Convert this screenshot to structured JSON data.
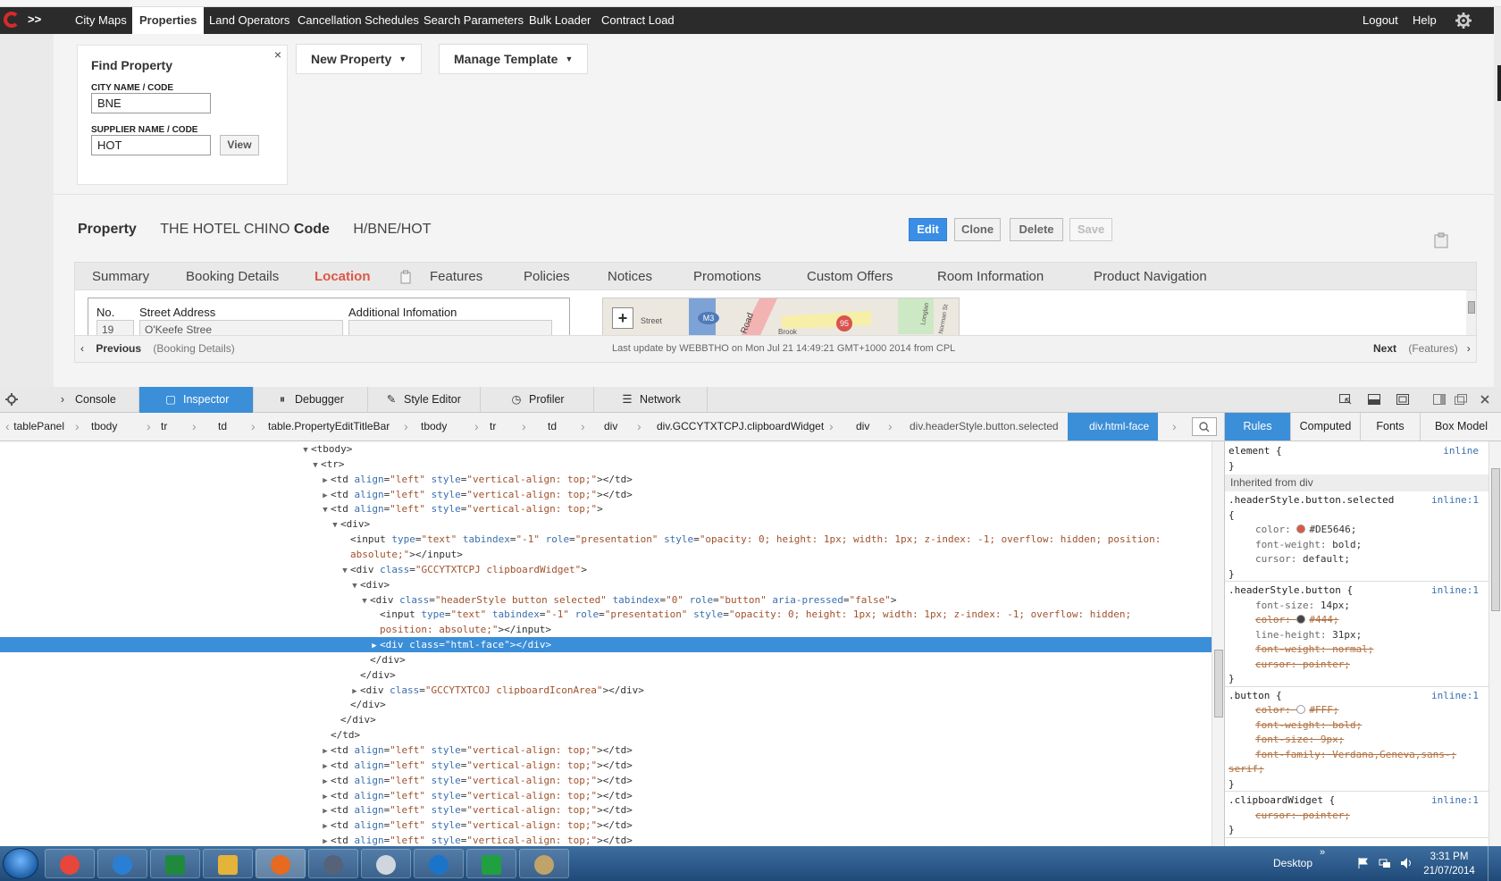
{
  "nav": {
    "items": [
      "City Maps",
      "Properties",
      "Land Operators",
      "Cancellation Schedules",
      "Search Parameters",
      "Bulk Loader",
      "Contract Load"
    ],
    "active": "Properties",
    "logout": "Logout",
    "help": "Help",
    "rail_chevron": ">>"
  },
  "find": {
    "title": "Find Property",
    "close": "×",
    "city_label": "CITY NAME / CODE",
    "city_value": "BNE",
    "supplier_label": "SUPPLIER NAME / CODE",
    "supplier_value": "HOT",
    "view": "View"
  },
  "toolbar": {
    "new_property": "New Property",
    "manage_template": "Manage Template",
    "caret": "▼"
  },
  "property": {
    "label": "Property",
    "name": "THE HOTEL CHINO",
    "code_label": "Code",
    "code": "H/BNE/HOT",
    "edit": "Edit",
    "clone": "Clone",
    "delete": "Delete",
    "save": "Save"
  },
  "tabs": [
    "Summary",
    "Booking Details",
    "Location",
    "Features",
    "Policies",
    "Notices",
    "Promotions",
    "Custom Offers",
    "Room Information",
    "Product Navigation"
  ],
  "selected_tab": "Location",
  "location": {
    "headers": [
      "No.",
      "Street Address",
      "Additional Infomation"
    ],
    "no": "19",
    "street": "O'Keefe Stree",
    "additional": "",
    "map_zoom": "+",
    "map_labels": [
      "Street",
      "M3",
      "Road",
      "95",
      "Brook",
      "Norman St",
      "Longlan"
    ]
  },
  "pager": {
    "previous": "Previous",
    "previous_target": "(Booking Details)",
    "update": "Last update by WEBBTHO on Mon Jul 21 14:49:21 GMT+1000 2014 from CPL",
    "next": "Next",
    "next_target": "(Features)"
  },
  "devtools": {
    "tabs": [
      {
        "label": "Console",
        "icon": "›"
      },
      {
        "label": "Inspector",
        "icon": "▢"
      },
      {
        "label": "Debugger",
        "icon": "⏸"
      },
      {
        "label": "Style Editor",
        "icon": "✎"
      },
      {
        "label": "Profiler",
        "icon": "◷"
      },
      {
        "label": "Network",
        "icon": "☰"
      }
    ],
    "active_tab": "Inspector",
    "breadcrumbs": [
      "tablePanel",
      "tbody",
      "tr",
      "td",
      "table.PropertyEditTitleBar",
      "tbody",
      "tr",
      "td",
      "div",
      "div.GCCYTXTCPJ.clipboardWidget",
      "div",
      "div.headerStyle.button.selected",
      "div.html-face"
    ],
    "sidebar_tabs": [
      "Rules",
      "Computed",
      "Fonts",
      "Box Model"
    ],
    "active_sidebar_tab": "Rules"
  },
  "markup": [
    {
      "indent": 0,
      "tw": "▼",
      "parts": [
        [
          "t",
          "<tbody>"
        ]
      ]
    },
    {
      "indent": 1,
      "tw": "▼",
      "parts": [
        [
          "t",
          "<tr>"
        ]
      ]
    },
    {
      "indent": 2,
      "tw": "▶",
      "parts": [
        [
          "t",
          "<td "
        ],
        [
          "an",
          "align"
        ],
        [
          "t",
          "="
        ],
        [
          "av",
          "\"left\""
        ],
        [
          "t",
          " "
        ],
        [
          "an",
          "style"
        ],
        [
          "t",
          "="
        ],
        [
          "av",
          "\"vertical-align: top;\""
        ],
        [
          "t",
          "></td>"
        ]
      ]
    },
    {
      "indent": 2,
      "tw": "▶",
      "parts": [
        [
          "t",
          "<td "
        ],
        [
          "an",
          "align"
        ],
        [
          "t",
          "="
        ],
        [
          "av",
          "\"left\""
        ],
        [
          "t",
          " "
        ],
        [
          "an",
          "style"
        ],
        [
          "t",
          "="
        ],
        [
          "av",
          "\"vertical-align: top;\""
        ],
        [
          "t",
          "></td>"
        ]
      ]
    },
    {
      "indent": 2,
      "tw": "▼",
      "parts": [
        [
          "t",
          "<td "
        ],
        [
          "an",
          "align"
        ],
        [
          "t",
          "="
        ],
        [
          "av",
          "\"left\""
        ],
        [
          "t",
          " "
        ],
        [
          "an",
          "style"
        ],
        [
          "t",
          "="
        ],
        [
          "av",
          "\"vertical-align: top;\""
        ],
        [
          "t",
          ">"
        ]
      ]
    },
    {
      "indent": 3,
      "tw": "▼",
      "parts": [
        [
          "t",
          "<div>"
        ]
      ]
    },
    {
      "indent": 4,
      "tw": "",
      "parts": [
        [
          "t",
          "<input "
        ],
        [
          "an",
          "type"
        ],
        [
          "t",
          "="
        ],
        [
          "av",
          "\"text\""
        ],
        [
          "t",
          " "
        ],
        [
          "an",
          "tabindex"
        ],
        [
          "t",
          "="
        ],
        [
          "av",
          "\"-1\""
        ],
        [
          "t",
          " "
        ],
        [
          "an",
          "role"
        ],
        [
          "t",
          "="
        ],
        [
          "av",
          "\"presentation\""
        ],
        [
          "t",
          " "
        ],
        [
          "an",
          "style"
        ],
        [
          "t",
          "="
        ],
        [
          "av",
          "\"opacity: 0; height: 1px; width: 1px; z-index: -1; overflow: hidden; position:"
        ]
      ]
    },
    {
      "indent": 4,
      "tw": "",
      "parts": [
        [
          "av",
          "absolute;\""
        ],
        [
          "t",
          "></input>"
        ]
      ]
    },
    {
      "indent": 4,
      "tw": "▼",
      "parts": [
        [
          "t",
          "<div "
        ],
        [
          "an",
          "class"
        ],
        [
          "t",
          "="
        ],
        [
          "av",
          "\"GCCYTXTCPJ clipboardWidget\""
        ],
        [
          "t",
          ">"
        ]
      ]
    },
    {
      "indent": 5,
      "tw": "▼",
      "parts": [
        [
          "t",
          "<div>"
        ]
      ]
    },
    {
      "indent": 6,
      "tw": "▼",
      "parts": [
        [
          "t",
          "<div "
        ],
        [
          "an",
          "class"
        ],
        [
          "t",
          "="
        ],
        [
          "av",
          "\"headerStyle button selected\""
        ],
        [
          "t",
          " "
        ],
        [
          "an",
          "tabindex"
        ],
        [
          "t",
          "="
        ],
        [
          "av",
          "\"0\""
        ],
        [
          "t",
          " "
        ],
        [
          "an",
          "role"
        ],
        [
          "t",
          "="
        ],
        [
          "av",
          "\"button\""
        ],
        [
          "t",
          " "
        ],
        [
          "an",
          "aria-pressed"
        ],
        [
          "t",
          "="
        ],
        [
          "av",
          "\"false\""
        ],
        [
          "t",
          ">"
        ]
      ]
    },
    {
      "indent": 7,
      "tw": "",
      "parts": [
        [
          "t",
          "<input "
        ],
        [
          "an",
          "type"
        ],
        [
          "t",
          "="
        ],
        [
          "av",
          "\"text\""
        ],
        [
          "t",
          " "
        ],
        [
          "an",
          "tabindex"
        ],
        [
          "t",
          "="
        ],
        [
          "av",
          "\"-1\""
        ],
        [
          "t",
          " "
        ],
        [
          "an",
          "role"
        ],
        [
          "t",
          "="
        ],
        [
          "av",
          "\"presentation\""
        ],
        [
          "t",
          " "
        ],
        [
          "an",
          "style"
        ],
        [
          "t",
          "="
        ],
        [
          "av",
          "\"opacity: 0; height: 1px; width: 1px; z-index: -1; overflow: hidden;"
        ]
      ]
    },
    {
      "indent": 7,
      "tw": "",
      "parts": [
        [
          "av",
          "position: absolute;\""
        ],
        [
          "t",
          "></input>"
        ]
      ]
    },
    {
      "indent": 7,
      "tw": "▶",
      "sel": true,
      "parts": [
        [
          "t",
          "<div "
        ],
        [
          "an",
          "class"
        ],
        [
          "t",
          "="
        ],
        [
          "av",
          "\"html-face\""
        ],
        [
          "t",
          "></div>"
        ]
      ]
    },
    {
      "indent": 6,
      "tw": "",
      "parts": [
        [
          "t",
          "</div>"
        ]
      ]
    },
    {
      "indent": 5,
      "tw": "",
      "parts": [
        [
          "t",
          "</div>"
        ]
      ]
    },
    {
      "indent": 5,
      "tw": "▶",
      "parts": [
        [
          "t",
          "<div "
        ],
        [
          "an",
          "class"
        ],
        [
          "t",
          "="
        ],
        [
          "av",
          "\"GCCYTXTCOJ clipboardIconArea\""
        ],
        [
          "t",
          "></div>"
        ]
      ]
    },
    {
      "indent": 4,
      "tw": "",
      "parts": [
        [
          "t",
          "</div>"
        ]
      ]
    },
    {
      "indent": 3,
      "tw": "",
      "parts": [
        [
          "t",
          "</div>"
        ]
      ]
    },
    {
      "indent": 2,
      "tw": "",
      "parts": [
        [
          "t",
          "</td>"
        ]
      ]
    },
    {
      "indent": 2,
      "tw": "▶",
      "parts": [
        [
          "t",
          "<td "
        ],
        [
          "an",
          "align"
        ],
        [
          "t",
          "="
        ],
        [
          "av",
          "\"left\""
        ],
        [
          "t",
          " "
        ],
        [
          "an",
          "style"
        ],
        [
          "t",
          "="
        ],
        [
          "av",
          "\"vertical-align: top;\""
        ],
        [
          "t",
          "></td>"
        ]
      ]
    },
    {
      "indent": 2,
      "tw": "▶",
      "parts": [
        [
          "t",
          "<td "
        ],
        [
          "an",
          "align"
        ],
        [
          "t",
          "="
        ],
        [
          "av",
          "\"left\""
        ],
        [
          "t",
          " "
        ],
        [
          "an",
          "style"
        ],
        [
          "t",
          "="
        ],
        [
          "av",
          "\"vertical-align: top;\""
        ],
        [
          "t",
          "></td>"
        ]
      ]
    },
    {
      "indent": 2,
      "tw": "▶",
      "parts": [
        [
          "t",
          "<td "
        ],
        [
          "an",
          "align"
        ],
        [
          "t",
          "="
        ],
        [
          "av",
          "\"left\""
        ],
        [
          "t",
          " "
        ],
        [
          "an",
          "style"
        ],
        [
          "t",
          "="
        ],
        [
          "av",
          "\"vertical-align: top;\""
        ],
        [
          "t",
          "></td>"
        ]
      ]
    },
    {
      "indent": 2,
      "tw": "▶",
      "parts": [
        [
          "t",
          "<td "
        ],
        [
          "an",
          "align"
        ],
        [
          "t",
          "="
        ],
        [
          "av",
          "\"left\""
        ],
        [
          "t",
          " "
        ],
        [
          "an",
          "style"
        ],
        [
          "t",
          "="
        ],
        [
          "av",
          "\"vertical-align: top;\""
        ],
        [
          "t",
          "></td>"
        ]
      ]
    },
    {
      "indent": 2,
      "tw": "▶",
      "parts": [
        [
          "t",
          "<td "
        ],
        [
          "an",
          "align"
        ],
        [
          "t",
          "="
        ],
        [
          "av",
          "\"left\""
        ],
        [
          "t",
          " "
        ],
        [
          "an",
          "style"
        ],
        [
          "t",
          "="
        ],
        [
          "av",
          "\"vertical-align: top;\""
        ],
        [
          "t",
          "></td>"
        ]
      ]
    },
    {
      "indent": 2,
      "tw": "▶",
      "parts": [
        [
          "t",
          "<td "
        ],
        [
          "an",
          "align"
        ],
        [
          "t",
          "="
        ],
        [
          "av",
          "\"left\""
        ],
        [
          "t",
          " "
        ],
        [
          "an",
          "style"
        ],
        [
          "t",
          "="
        ],
        [
          "av",
          "\"vertical-align: top;\""
        ],
        [
          "t",
          "></td>"
        ]
      ]
    },
    {
      "indent": 2,
      "tw": "▶",
      "parts": [
        [
          "t",
          "<td "
        ],
        [
          "an",
          "align"
        ],
        [
          "t",
          "="
        ],
        [
          "av",
          "\"left\""
        ],
        [
          "t",
          " "
        ],
        [
          "an",
          "style"
        ],
        [
          "t",
          "="
        ],
        [
          "av",
          "\"vertical-align: top;\""
        ],
        [
          "t",
          "></td>"
        ]
      ]
    }
  ],
  "rules": {
    "element_selector": "element {",
    "inline": "inline",
    "close": "}",
    "inherited": "Inherited from div",
    "blocks": [
      {
        "selector": ".headerStyle.button.selected",
        "src": "inline:1",
        "props": [
          {
            "name": "color",
            "value": "#DE5646",
            "swatch": "#DE5646"
          },
          {
            "name": "font-weight",
            "value": "bold"
          },
          {
            "name": "cursor",
            "value": "default"
          }
        ]
      },
      {
        "selector": ".headerStyle.button",
        "src": "inline:1",
        "props": [
          {
            "name": "font-size",
            "value": "14px"
          },
          {
            "name": "color",
            "value": "#444",
            "swatch": "#444444",
            "strike": true
          },
          {
            "name": "line-height",
            "value": "31px"
          },
          {
            "name": "font-weight",
            "value": "normal",
            "strike": true
          },
          {
            "name": "cursor",
            "value": "pointer",
            "strike": true
          }
        ]
      },
      {
        "selector": ".button",
        "src": "inline:1",
        "props": [
          {
            "name": "color",
            "value": "#FFF",
            "swatch": "#FFFFFF",
            "strike": true
          },
          {
            "name": "font-weight",
            "value": "bold",
            "strike": true
          },
          {
            "name": "font-size",
            "value": "9px",
            "strike": true
          },
          {
            "name": "font-family",
            "value": "Verdana,Geneva,sans-",
            "strike": true
          },
          {
            "name": "",
            "value": "serif",
            "strike": true,
            "wrap": true
          }
        ]
      },
      {
        "selector": ".clipboardWidget",
        "src": "inline:1",
        "props": [
          {
            "name": "cursor",
            "value": "pointer",
            "strike": true
          }
        ]
      }
    ]
  },
  "taskbar": {
    "desktop": "Desktop",
    "chevron": "»",
    "time": "3:31 PM",
    "date": "21/07/2014",
    "apps": [
      "chrome",
      "internet-explorer",
      "excel",
      "file-explorer",
      "firefox",
      "app-a",
      "clock-app",
      "teamviewer",
      "remote-desktop",
      "paint"
    ]
  }
}
